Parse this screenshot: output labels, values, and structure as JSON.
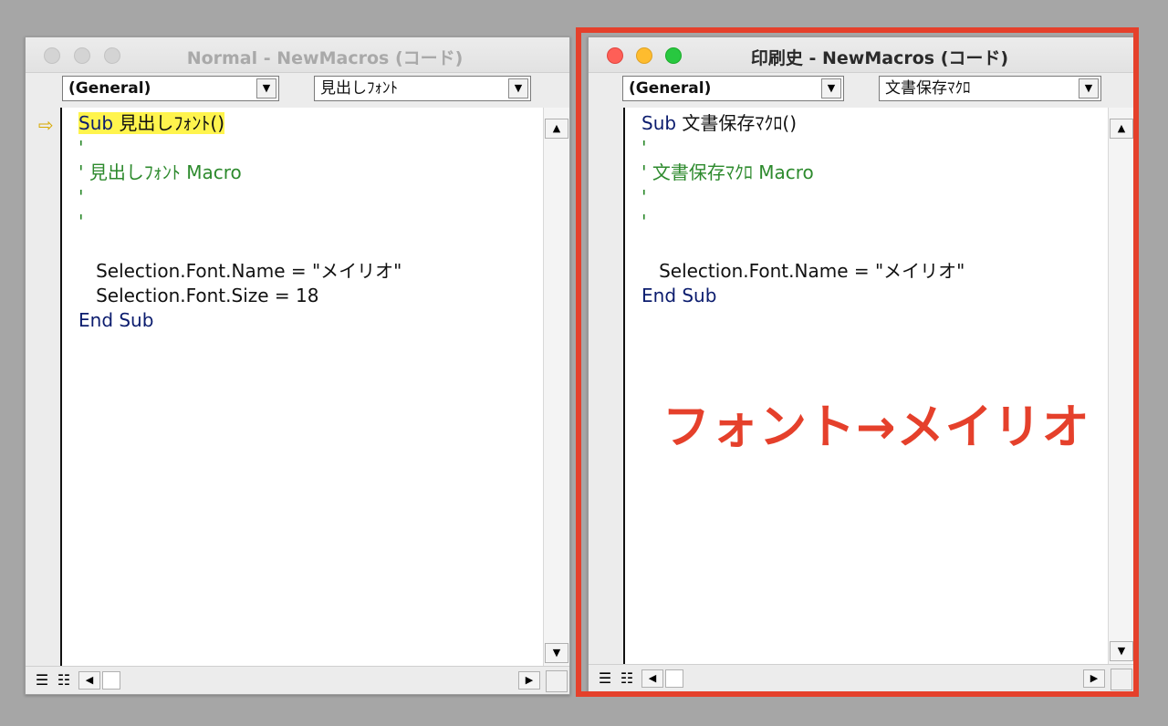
{
  "left_window": {
    "title": "Normal - NewMacros (コード)",
    "object_select": "(General)",
    "proc_select": "見出しﾌｫﾝﾄ",
    "exec_arrow": "⇨",
    "code": {
      "l1_kw": "Sub",
      "l1_name": " 見出しﾌｫﾝﾄ()",
      "l2": "'",
      "l3": "' 見出しﾌｫﾝﾄ Macro",
      "l4": "'",
      "l5": "'",
      "l6": "",
      "l7": "   Selection.Font.Name = \"メイリオ\"",
      "l8": "   Selection.Font.Size = 18",
      "l9": "End Sub"
    }
  },
  "right_window": {
    "title": "印刷史 - NewMacros (コード)",
    "object_select": "(General)",
    "proc_select": "文書保存ﾏｸﾛ",
    "code": {
      "l1_kw": "Sub",
      "l1_name": " 文書保存ﾏｸﾛ()",
      "l2": "'",
      "l3": "' 文書保存ﾏｸﾛ Macro",
      "l4": "'",
      "l5": "'",
      "l6": "",
      "l7": "   Selection.Font.Name = \"メイリオ\"",
      "l8": "End Sub"
    }
  },
  "annotation": "フォント→メイリオ",
  "icons": {
    "dropdown_arrow": "▼",
    "scroll_up": "▲",
    "scroll_down": "▼",
    "scroll_left": "◀",
    "scroll_right": "▶",
    "view_procedure": "☰",
    "view_full": "☷"
  },
  "colors": {
    "highlight_frame": "#e5402b",
    "keyword": "#0b1c6e",
    "comment": "#2d8a2d",
    "current_line": "#fff44d"
  }
}
